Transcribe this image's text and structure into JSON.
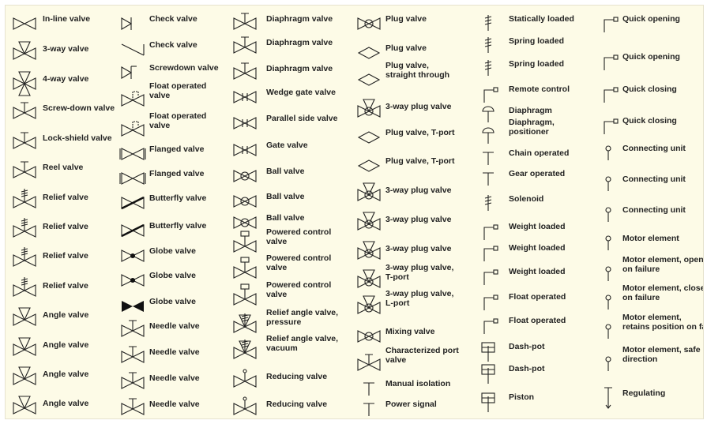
{
  "columns": [
    {
      "items": [
        {
          "label": "In-line valve",
          "icon": "inline-valve-icon"
        },
        {
          "label": "3-way valve",
          "icon": "three-way-valve-icon"
        },
        {
          "label": "4-way valve",
          "icon": "four-way-valve-icon"
        },
        {
          "label": "Screw-down valve",
          "icon": "screw-down-valve-icon"
        },
        {
          "label": "Lock-shield valve",
          "icon": "lock-shield-valve-icon"
        },
        {
          "label": "Reel valve",
          "icon": "reel-valve-icon"
        },
        {
          "label": "Relief valve",
          "icon": "relief-valve-icon"
        },
        {
          "label": "Relief valve",
          "icon": "relief-valve-icon"
        },
        {
          "label": "Relief valve",
          "icon": "relief-valve-icon"
        },
        {
          "label": "Relief valve",
          "icon": "relief-valve-icon"
        },
        {
          "label": "Angle valve",
          "icon": "angle-valve-icon"
        },
        {
          "label": "Angle valve",
          "icon": "angle-valve-icon"
        },
        {
          "label": "Angle valve",
          "icon": "angle-valve-icon"
        },
        {
          "label": "Angle valve",
          "icon": "angle-valve-icon"
        }
      ]
    },
    {
      "items": [
        {
          "label": "Check valve",
          "icon": "check-valve-icon"
        },
        {
          "label": "Check valve",
          "icon": "check-valve-line-icon"
        },
        {
          "label": "Screwdown valve",
          "icon": "screwdown-check-valve-icon"
        },
        {
          "label": "Float operated\nvalve",
          "icon": "float-operated-valve-icon"
        },
        {
          "label": "Float operated\nvalve",
          "icon": "float-operated-valve-icon"
        },
        {
          "label": "Flanged valve",
          "icon": "flanged-valve-icon"
        },
        {
          "label": "Flanged valve",
          "icon": "flanged-valve-icon"
        },
        {
          "label": "Butterfly valve",
          "icon": "butterfly-valve-icon"
        },
        {
          "label": "Butterfly valve",
          "icon": "butterfly-valve-icon"
        },
        {
          "label": "Globe valve",
          "icon": "globe-valve-icon"
        },
        {
          "label": "Globe valve",
          "icon": "globe-valve-icon"
        },
        {
          "label": "Globe valve",
          "icon": "globe-valve-filled-icon"
        },
        {
          "label": "Needle valve",
          "icon": "needle-valve-icon"
        },
        {
          "label": "Needle valve",
          "icon": "needle-valve-icon"
        },
        {
          "label": "Needle valve",
          "icon": "needle-valve-icon"
        },
        {
          "label": "Needle valve",
          "icon": "needle-valve-icon"
        }
      ]
    },
    {
      "items": [
        {
          "label": "Diaphragm valve",
          "icon": "diaphragm-valve-icon"
        },
        {
          "label": "Diaphragm valve",
          "icon": "diaphragm-valve-icon"
        },
        {
          "label": "Diaphragm valve",
          "icon": "diaphragm-valve-icon"
        },
        {
          "label": "Wedge gate valve",
          "icon": "wedge-gate-valve-icon"
        },
        {
          "label": "Parallel side valve",
          "icon": "parallel-side-valve-icon"
        },
        {
          "label": "Gate valve",
          "icon": "gate-valve-icon"
        },
        {
          "label": "Ball valve",
          "icon": "ball-valve-icon"
        },
        {
          "label": "Ball valve",
          "icon": "ball-valve-icon"
        },
        {
          "label": "Ball valve",
          "icon": "ball-valve-icon"
        },
        {
          "label": "Powered control\nvalve",
          "icon": "powered-control-valve-icon"
        },
        {
          "label": "Powered control\nvalve",
          "icon": "powered-control-valve-icon"
        },
        {
          "label": "Powered control\nvalve",
          "icon": "powered-control-valve-icon"
        },
        {
          "label": "Relief angle valve,\npressure",
          "icon": "relief-angle-valve-icon"
        },
        {
          "label": "Relief angle valve,\nvacuum",
          "icon": "relief-angle-valve-icon"
        },
        {
          "label": "Reducing valve",
          "icon": "reducing-valve-icon"
        },
        {
          "label": "Reducing valve",
          "icon": "reducing-valve-icon"
        }
      ]
    },
    {
      "items": [
        {
          "label": "Plug valve",
          "icon": "plug-valve-icon"
        },
        {
          "label": "Plug valve",
          "icon": "plug-valve-diamond-icon"
        },
        {
          "label": "Plug valve,\nstraight through",
          "icon": "plug-valve-diamond-icon"
        },
        {
          "label": "3-way plug valve",
          "icon": "three-way-plug-valve-icon"
        },
        {
          "label": "Plug valve, T-port",
          "icon": "plug-valve-diamond-icon"
        },
        {
          "label": "Plug valve, T-port",
          "icon": "plug-valve-diamond-icon"
        },
        {
          "label": "3-way plug valve",
          "icon": "three-way-plug-valve-icon"
        },
        {
          "label": "3-way plug valve",
          "icon": "three-way-plug-valve-icon"
        },
        {
          "label": "3-way plug valve",
          "icon": "three-way-plug-valve-icon"
        },
        {
          "label": "3-way plug valve,\nT-port",
          "icon": "three-way-plug-valve-icon"
        },
        {
          "label": "3-way plug valve,\nL-port",
          "icon": "three-way-plug-valve-icon"
        },
        {
          "label": "Mixing valve",
          "icon": "mixing-valve-icon"
        },
        {
          "label": "Characterized port\nvalve",
          "icon": "characterized-port-valve-icon"
        },
        {
          "label": "Manual isolation",
          "icon": "manual-isolation-icon"
        },
        {
          "label": "Power signal",
          "icon": "power-signal-icon"
        }
      ]
    },
    {
      "items": [
        {
          "label": "Statically loaded",
          "icon": "statically-loaded-icon"
        },
        {
          "label": "Spring loaded",
          "icon": "spring-loaded-icon"
        },
        {
          "label": "Spring loaded",
          "icon": "spring-loaded-icon"
        },
        {
          "label": "Remote control",
          "icon": "remote-control-icon"
        },
        {
          "label": "Diaphragm",
          "icon": "diaphragm-icon"
        },
        {
          "label": "Diaphragm,\npositioner",
          "icon": "diaphragm-positioner-icon"
        },
        {
          "label": "Chain operated",
          "icon": "chain-operated-icon"
        },
        {
          "label": "Gear operated",
          "icon": "gear-operated-icon"
        },
        {
          "label": "Solenoid",
          "icon": "solenoid-icon"
        },
        {
          "label": "Weight loaded",
          "icon": "weight-loaded-icon"
        },
        {
          "label": "Weight loaded",
          "icon": "weight-loaded-icon"
        },
        {
          "label": "Weight loaded",
          "icon": "weight-loaded-icon"
        },
        {
          "label": "Float operated",
          "icon": "float-operated-icon"
        },
        {
          "label": "Float operated",
          "icon": "float-operated-icon"
        },
        {
          "label": "Dash-pot",
          "icon": "dash-pot-icon"
        },
        {
          "label": "Dash-pot",
          "icon": "dash-pot-icon"
        },
        {
          "label": "Piston",
          "icon": "piston-icon"
        }
      ]
    },
    {
      "items": [
        {
          "label": "Quick opening",
          "icon": "quick-opening-icon"
        },
        {
          "label": "Quick opening",
          "icon": "quick-opening-arrow-icon"
        },
        {
          "label": "Quick closing",
          "icon": "quick-closing-icon"
        },
        {
          "label": "Quick closing",
          "icon": "quick-closing-arrow-icon"
        },
        {
          "label": "Connecting unit",
          "icon": "connecting-unit-icon"
        },
        {
          "label": "Connecting unit",
          "icon": "connecting-unit-icon"
        },
        {
          "label": "Connecting unit",
          "icon": "connecting-unit-circle-icon"
        },
        {
          "label": "Motor element",
          "icon": "motor-element-icon"
        },
        {
          "label": "Motor element, opens\non failure",
          "icon": "motor-element-icon"
        },
        {
          "label": "Motor element, closes\non failure",
          "icon": "motor-element-icon"
        },
        {
          "label": "Motor element,\nretains position on fail",
          "icon": "motor-element-icon"
        },
        {
          "label": "Motor element, safe\ndirection",
          "icon": "motor-element-icon"
        },
        {
          "label": "Regulating",
          "icon": "regulating-icon"
        }
      ]
    }
  ]
}
